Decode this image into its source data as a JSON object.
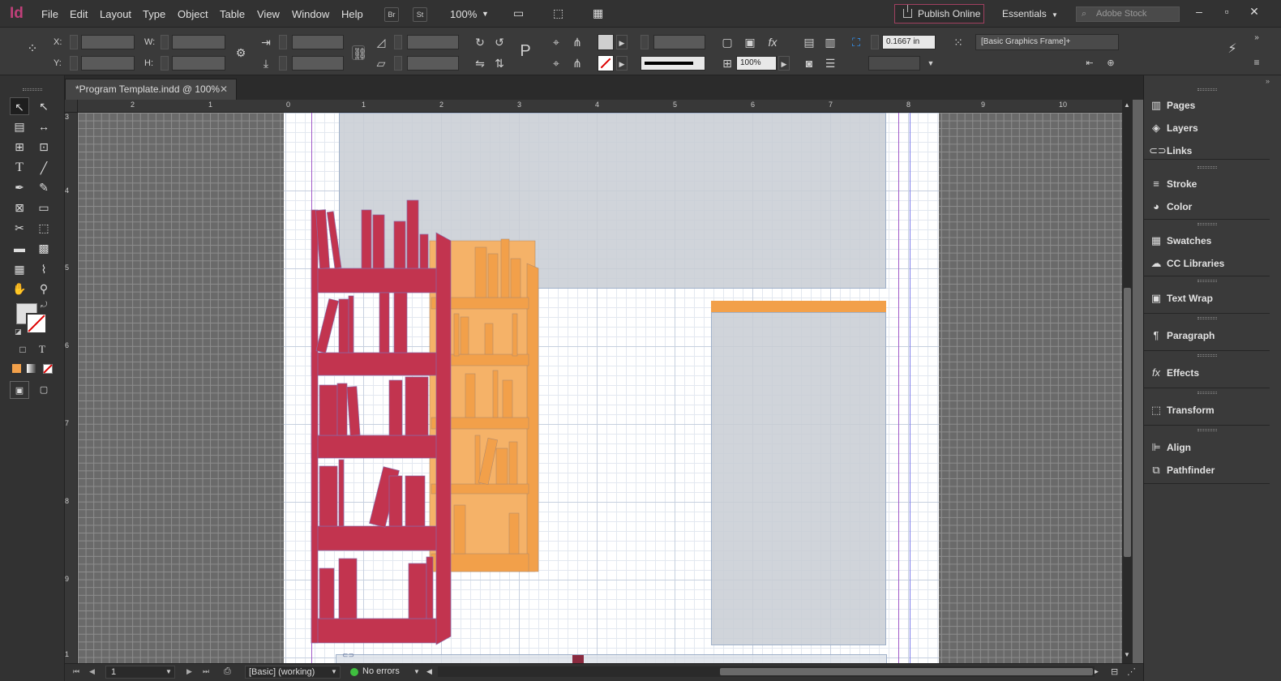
{
  "app": {
    "logo": "Id",
    "publish_label": "Publish Online",
    "workspace": "Essentials",
    "stock_placeholder": "Adobe Stock",
    "bridge_chip": "Br",
    "stock_chip": "St",
    "zoom": "100%"
  },
  "menu": [
    "File",
    "Edit",
    "Layout",
    "Type",
    "Object",
    "Table",
    "View",
    "Window",
    "Help"
  ],
  "control": {
    "x_label": "X:",
    "y_label": "Y:",
    "w_label": "W:",
    "h_label": "H:",
    "stroke_weight": "0.1667 in",
    "opacity": "100%",
    "object_style": "[Basic Graphics Frame]+"
  },
  "document": {
    "tab_title": "*Program Template.indd @ 100%"
  },
  "ruler": {
    "h_ticks": [
      "2",
      "1",
      "0",
      "1",
      "2",
      "3",
      "4",
      "5",
      "6",
      "7",
      "8",
      "9",
      "10"
    ],
    "v_ticks": [
      "3",
      "4",
      "5",
      "6",
      "7",
      "8",
      "9",
      "1"
    ]
  },
  "status": {
    "page": "1",
    "mode": "[Basic] (working)",
    "preflight": "No errors",
    "preflight_color": "#3fbf3f"
  },
  "panels": [
    "Pages",
    "Layers",
    "Links",
    "Stroke",
    "Color",
    "Swatches",
    "CC Libraries",
    "Text Wrap",
    "Paragraph",
    "Effects",
    "Transform",
    "Align",
    "Pathfinder"
  ],
  "colors": {
    "crimson": "#c2344f",
    "orange": "#f2a04a",
    "frame_fill": "#c8cdd4",
    "margin": "#a15ac8",
    "accent": "#c0407a"
  }
}
